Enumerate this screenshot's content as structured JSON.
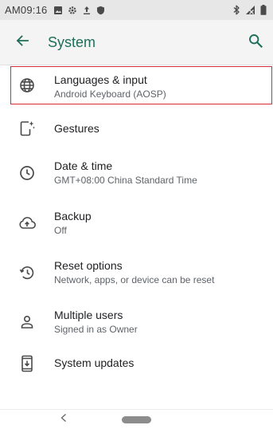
{
  "status_bar": {
    "time": "AM09:16",
    "left_icons": [
      "image-icon",
      "settings-icon",
      "upload-icon",
      "shield-icon"
    ],
    "right_icons": [
      "bluetooth-icon",
      "no-signal-icon",
      "battery-icon"
    ]
  },
  "app_bar": {
    "title": "System",
    "back_icon": "arrow-left-icon",
    "search_icon": "search-icon",
    "accent_color": "#1f6e59"
  },
  "items": [
    {
      "title": "Languages & input",
      "summary": "Android Keyboard (AOSP)",
      "icon": "globe-icon"
    },
    {
      "title": "Gestures",
      "summary": "",
      "icon": "gestures-icon"
    },
    {
      "title": "Date & time",
      "summary": "GMT+08:00 China Standard Time",
      "icon": "clock-icon"
    },
    {
      "title": "Backup",
      "summary": "Off",
      "icon": "cloud-upload-icon"
    },
    {
      "title": "Reset options",
      "summary": "Network, apps, or device can be reset",
      "icon": "restore-icon"
    },
    {
      "title": "Multiple users",
      "summary": "Signed in as Owner",
      "icon": "person-icon"
    },
    {
      "title": "System updates",
      "summary": "",
      "icon": "system-update-icon"
    }
  ],
  "highlight_color": "#d72a36",
  "nav_bar": {
    "back_icon": "nav-back-icon",
    "home_icon": "home-pill-icon"
  }
}
